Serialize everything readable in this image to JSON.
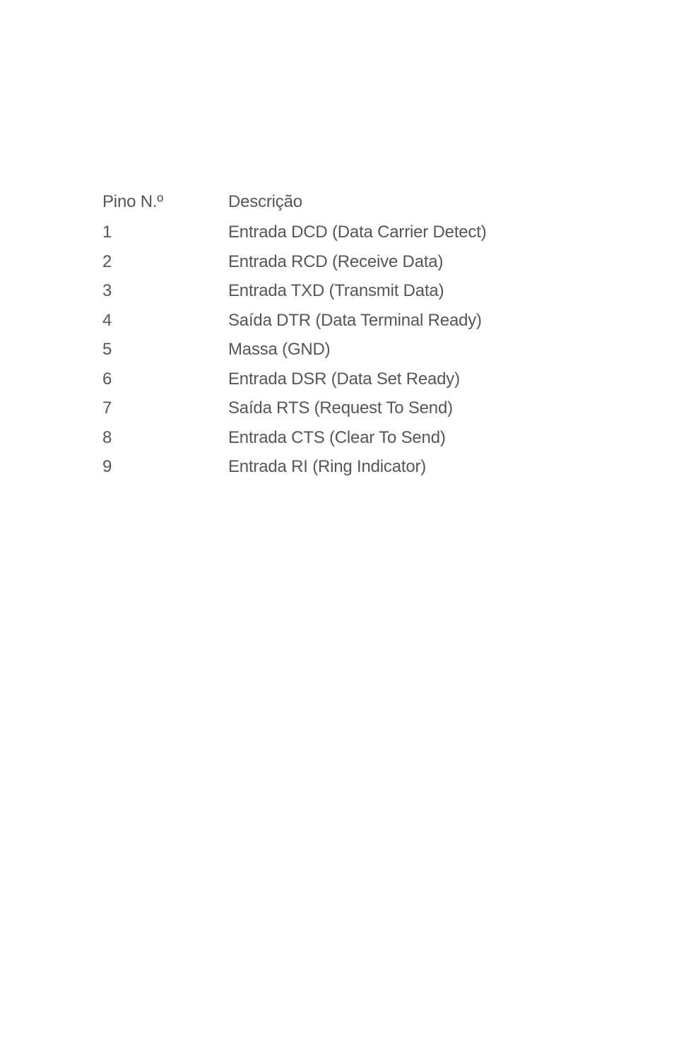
{
  "table": {
    "headers": {
      "pin": "Pino N.º",
      "desc": "Descrição"
    },
    "rows": [
      {
        "pin": "1",
        "desc": "Entrada DCD (Data Carrier Detect)"
      },
      {
        "pin": "2",
        "desc": "Entrada RCD (Receive Data)"
      },
      {
        "pin": "3",
        "desc": "Entrada TXD (Transmit Data)"
      },
      {
        "pin": "4",
        "desc": "Saída DTR (Data Terminal Ready)"
      },
      {
        "pin": "5",
        "desc": "Massa (GND)"
      },
      {
        "pin": "6",
        "desc": "Entrada DSR (Data Set Ready)"
      },
      {
        "pin": "7",
        "desc": "Saída RTS (Request To Send)"
      },
      {
        "pin": "8",
        "desc": "Entrada CTS (Clear To Send)"
      },
      {
        "pin": "9",
        "desc": "Entrada RI (Ring Indicator)"
      }
    ]
  }
}
